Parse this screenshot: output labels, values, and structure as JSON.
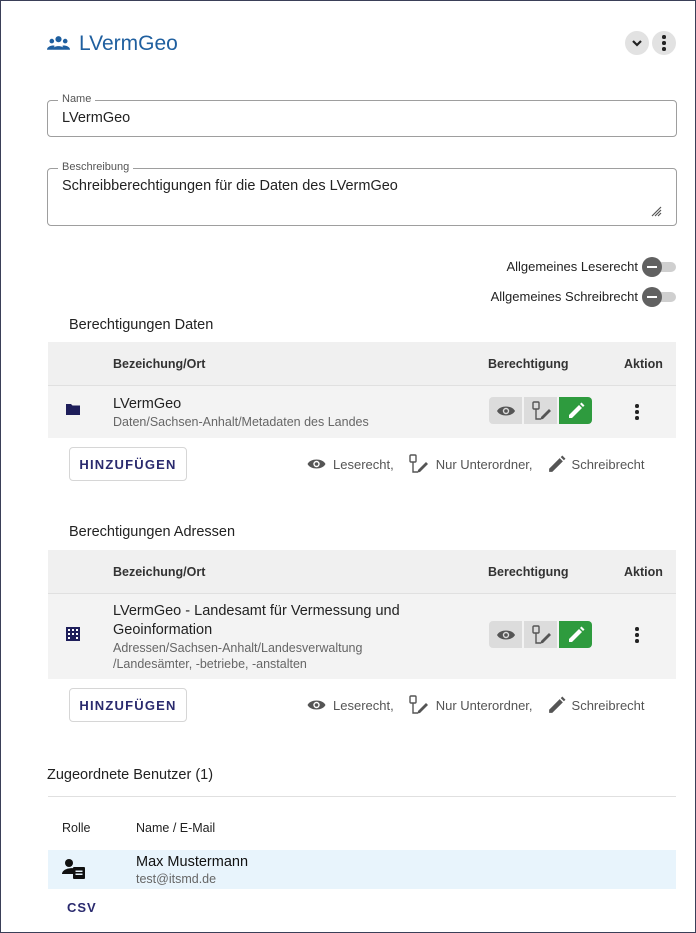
{
  "header": {
    "title": "LVermGeo",
    "icon": "group-icon"
  },
  "form": {
    "name_label": "Name",
    "name_value": "LVermGeo",
    "description_label": "Beschreibung",
    "description_value": "Schreibberechtigungen für die Daten des LVermGeo"
  },
  "toggles": {
    "read_label": "Allgemeines Leserecht",
    "write_label": "Allgemeines Schreibrecht",
    "read_on": false,
    "write_on": false
  },
  "data_permissions": {
    "title": "Berechtigungen Daten",
    "columns": [
      "Bezeichung/Ort",
      "Berechtigung",
      "Aktion"
    ],
    "rows": [
      {
        "title": "LVermGeo",
        "subtitle": "Daten/Sachsen-Anhalt/Metadaten des Landes",
        "icon": "folder-icon",
        "permission": "Schreibrecht"
      }
    ],
    "add_label": "HINZUFÜGEN"
  },
  "address_permissions": {
    "title": "Berechtigungen Adressen",
    "columns": [
      "Bezeichung/Ort",
      "Berechtigung",
      "Aktion"
    ],
    "rows": [
      {
        "title_line1": "LVermGeo - Landesamt für Vermessung und",
        "title_line2": "Geoinformation",
        "subtitle_line1": "Adressen/Sachsen-Anhalt/Landesverwaltung",
        "subtitle_line2": "/Landesämter, -betriebe, -anstalten",
        "icon": "building-icon",
        "permission": "Schreibrecht"
      }
    ],
    "add_label": "HINZUFÜGEN"
  },
  "legend": {
    "read": "Leserecht,",
    "subfolder": "Nur Unterordner,",
    "write": "Schreibrecht"
  },
  "users": {
    "title": "Zugeordnete Benutzer (1)",
    "columns": [
      "Rolle",
      "Name / E-Mail"
    ],
    "rows": [
      {
        "name": "Max Mustermann",
        "email": "test@itsmd.de",
        "role_icon": "user-role-icon"
      }
    ],
    "csv_label": "CSV"
  },
  "colors": {
    "accent": "#1f5f9f",
    "active_permission": "#2e9b3e",
    "button_text": "#2a2a6e"
  }
}
